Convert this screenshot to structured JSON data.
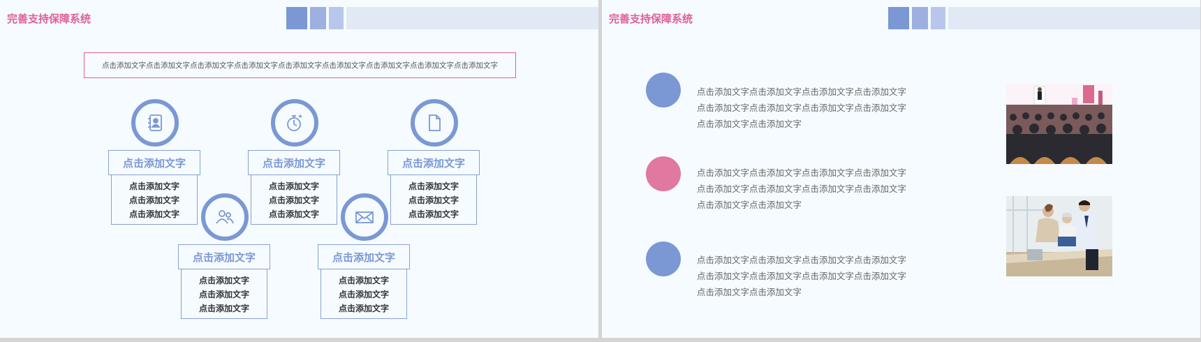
{
  "slides": [
    {
      "title": "完善支持保障系统",
      "intro": "点击添加文字点击添加文字点击添加文字点击添加文字点击添加文字点击添加文字点击添加文字点击添加文字点击添加文字",
      "features": [
        {
          "icon": "address-book-icon",
          "title": "点击添加文字",
          "lines": [
            "点击添加文字",
            "点击添加文字",
            "点击添加文字"
          ]
        },
        {
          "icon": "stopwatch-icon",
          "title": "点击添加文字",
          "lines": [
            "点击添加文字",
            "点击添加文字",
            "点击添加文字"
          ]
        },
        {
          "icon": "document-icon",
          "title": "点击添加文字",
          "lines": [
            "点击添加文字",
            "点击添加文字",
            "点击添加文字"
          ]
        },
        {
          "icon": "users-icon",
          "title": "点击添加文字",
          "lines": [
            "点击添加文字",
            "点击添加文字",
            "点击添加文字"
          ]
        },
        {
          "icon": "envelope-icon",
          "title": "点击添加文字",
          "lines": [
            "点击添加文字",
            "点击添加文字",
            "点击添加文字"
          ]
        }
      ]
    },
    {
      "title": "完善支持保障系统",
      "items": [
        {
          "color": "#7b98d4",
          "lines": [
            "点击添加文字点击添加文字点击添加文字点击添加文字",
            "点击添加文字点击添加文字点击添加文字点击添加文字",
            "点击添加文字点击添加文字"
          ]
        },
        {
          "color": "#e0789f",
          "lines": [
            "点击添加文字点击添加文字点击添加文字点击添加文字",
            "点击添加文字点击添加文字点击添加文字点击添加文字",
            "点击添加文字点击添加文字"
          ]
        },
        {
          "color": "#7b98d4",
          "lines": [
            "点击添加文字点击添加文字点击添加文字点击添加文字",
            "点击添加文字点击添加文字点击添加文字点击添加文字",
            "点击添加文字点击添加文字"
          ]
        }
      ],
      "photos": [
        "conference-audience-photo",
        "business-meeting-photo"
      ]
    }
  ],
  "colors": {
    "accent_blue": "#7b98d4",
    "accent_pink": "#e0609a",
    "background": "#f5fbff"
  }
}
